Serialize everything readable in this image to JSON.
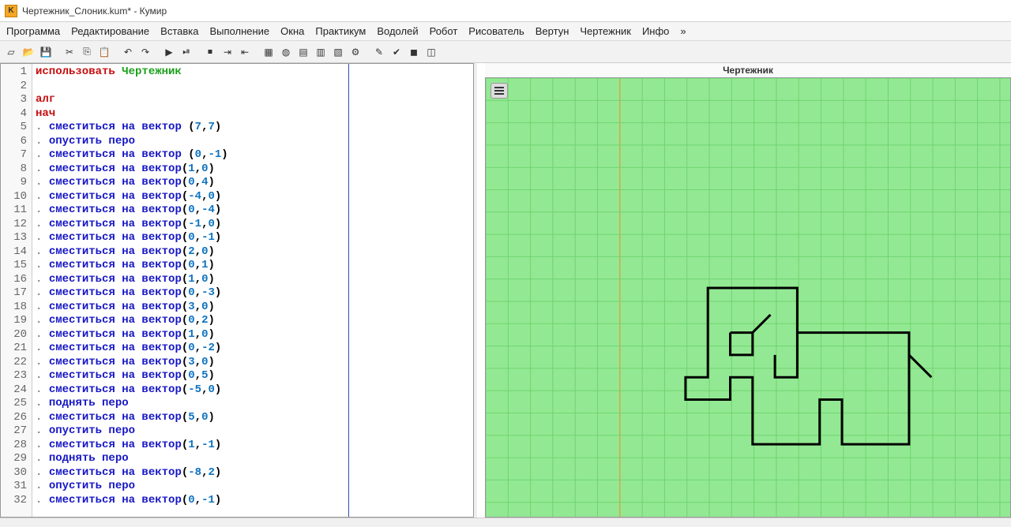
{
  "window": {
    "title": "Чертежник_Слоник.kum* - Кумир"
  },
  "menu": [
    "Программа",
    "Редактирование",
    "Вставка",
    "Выполнение",
    "Окна",
    "Практикум",
    "Водолей",
    "Робот",
    "Рисователь",
    "Вертун",
    "Чертежник",
    "Инфо",
    "»"
  ],
  "right_title": "Чертежник",
  "code": {
    "lines": [
      {
        "n": 1,
        "t": [
          {
            "c": "kw",
            "s": "использовать "
          },
          {
            "c": "grn",
            "s": "Чертежник"
          }
        ]
      },
      {
        "n": 2,
        "t": []
      },
      {
        "n": 3,
        "t": [
          {
            "c": "kw",
            "s": "алг"
          }
        ]
      },
      {
        "n": 4,
        "t": [
          {
            "c": "kw",
            "s": "нач"
          }
        ]
      },
      {
        "n": 5,
        "t": [
          {
            "c": "dot",
            "s": ". "
          },
          {
            "c": "cmd",
            "s": "сместиться на вектор "
          },
          {
            "c": "",
            "s": "("
          },
          {
            "c": "num",
            "s": "7"
          },
          {
            "c": "",
            "s": ","
          },
          {
            "c": "num",
            "s": "7"
          },
          {
            "c": "",
            "s": ")"
          }
        ]
      },
      {
        "n": 6,
        "t": [
          {
            "c": "dot",
            "s": ". "
          },
          {
            "c": "cmd",
            "s": "опустить перо"
          }
        ]
      },
      {
        "n": 7,
        "t": [
          {
            "c": "dot",
            "s": ". "
          },
          {
            "c": "cmd",
            "s": "сместиться на вектор "
          },
          {
            "c": "",
            "s": "("
          },
          {
            "c": "num",
            "s": "0"
          },
          {
            "c": "",
            "s": ","
          },
          {
            "c": "num",
            "s": "-1"
          },
          {
            "c": "",
            "s": ")"
          }
        ]
      },
      {
        "n": 8,
        "t": [
          {
            "c": "dot",
            "s": ". "
          },
          {
            "c": "cmd",
            "s": "сместиться на вектор"
          },
          {
            "c": "",
            "s": "("
          },
          {
            "c": "num",
            "s": "1"
          },
          {
            "c": "",
            "s": ","
          },
          {
            "c": "num",
            "s": "0"
          },
          {
            "c": "",
            "s": ")"
          }
        ]
      },
      {
        "n": 9,
        "t": [
          {
            "c": "dot",
            "s": ". "
          },
          {
            "c": "cmd",
            "s": "сместиться на вектор"
          },
          {
            "c": "",
            "s": "("
          },
          {
            "c": "num",
            "s": "0"
          },
          {
            "c": "",
            "s": ","
          },
          {
            "c": "num",
            "s": "4"
          },
          {
            "c": "",
            "s": ")"
          }
        ]
      },
      {
        "n": 10,
        "t": [
          {
            "c": "dot",
            "s": ". "
          },
          {
            "c": "cmd",
            "s": "сместиться на вектор"
          },
          {
            "c": "",
            "s": "("
          },
          {
            "c": "num",
            "s": "-4"
          },
          {
            "c": "",
            "s": ","
          },
          {
            "c": "num",
            "s": "0"
          },
          {
            "c": "",
            "s": ")"
          }
        ]
      },
      {
        "n": 11,
        "t": [
          {
            "c": "dot",
            "s": ". "
          },
          {
            "c": "cmd",
            "s": "сместиться на вектор"
          },
          {
            "c": "",
            "s": "("
          },
          {
            "c": "num",
            "s": "0"
          },
          {
            "c": "",
            "s": ","
          },
          {
            "c": "num",
            "s": "-4"
          },
          {
            "c": "",
            "s": ")"
          }
        ]
      },
      {
        "n": 12,
        "t": [
          {
            "c": "dot",
            "s": ". "
          },
          {
            "c": "cmd",
            "s": "сместиться на вектор"
          },
          {
            "c": "",
            "s": "("
          },
          {
            "c": "num",
            "s": "-1"
          },
          {
            "c": "",
            "s": ","
          },
          {
            "c": "num",
            "s": "0"
          },
          {
            "c": "",
            "s": ")"
          }
        ]
      },
      {
        "n": 13,
        "t": [
          {
            "c": "dot",
            "s": ". "
          },
          {
            "c": "cmd",
            "s": "сместиться на вектор"
          },
          {
            "c": "",
            "s": "("
          },
          {
            "c": "num",
            "s": "0"
          },
          {
            "c": "",
            "s": ","
          },
          {
            "c": "num",
            "s": "-1"
          },
          {
            "c": "",
            "s": ")"
          }
        ]
      },
      {
        "n": 14,
        "t": [
          {
            "c": "dot",
            "s": ". "
          },
          {
            "c": "cmd",
            "s": "сместиться на вектор"
          },
          {
            "c": "",
            "s": "("
          },
          {
            "c": "num",
            "s": "2"
          },
          {
            "c": "",
            "s": ","
          },
          {
            "c": "num",
            "s": "0"
          },
          {
            "c": "",
            "s": ")"
          }
        ]
      },
      {
        "n": 15,
        "t": [
          {
            "c": "dot",
            "s": ". "
          },
          {
            "c": "cmd",
            "s": "сместиться на вектор"
          },
          {
            "c": "",
            "s": "("
          },
          {
            "c": "num",
            "s": "0"
          },
          {
            "c": "",
            "s": ","
          },
          {
            "c": "num",
            "s": "1"
          },
          {
            "c": "",
            "s": ")"
          }
        ]
      },
      {
        "n": 16,
        "t": [
          {
            "c": "dot",
            "s": ". "
          },
          {
            "c": "cmd",
            "s": "сместиться на вектор"
          },
          {
            "c": "",
            "s": "("
          },
          {
            "c": "num",
            "s": "1"
          },
          {
            "c": "",
            "s": ","
          },
          {
            "c": "num",
            "s": "0"
          },
          {
            "c": "",
            "s": ")"
          }
        ]
      },
      {
        "n": 17,
        "t": [
          {
            "c": "dot",
            "s": ". "
          },
          {
            "c": "cmd",
            "s": "сместиться на вектор"
          },
          {
            "c": "",
            "s": "("
          },
          {
            "c": "num",
            "s": "0"
          },
          {
            "c": "",
            "s": ","
          },
          {
            "c": "num",
            "s": "-3"
          },
          {
            "c": "",
            "s": ")"
          }
        ]
      },
      {
        "n": 18,
        "t": [
          {
            "c": "dot",
            "s": ". "
          },
          {
            "c": "cmd",
            "s": "сместиться на вектор"
          },
          {
            "c": "",
            "s": "("
          },
          {
            "c": "num",
            "s": "3"
          },
          {
            "c": "",
            "s": ","
          },
          {
            "c": "num",
            "s": "0"
          },
          {
            "c": "",
            "s": ")"
          }
        ]
      },
      {
        "n": 19,
        "t": [
          {
            "c": "dot",
            "s": ". "
          },
          {
            "c": "cmd",
            "s": "сместиться на вектор"
          },
          {
            "c": "",
            "s": "("
          },
          {
            "c": "num",
            "s": "0"
          },
          {
            "c": "",
            "s": ","
          },
          {
            "c": "num",
            "s": "2"
          },
          {
            "c": "",
            "s": ")"
          }
        ]
      },
      {
        "n": 20,
        "t": [
          {
            "c": "dot",
            "s": ". "
          },
          {
            "c": "cmd",
            "s": "сместиться на вектор"
          },
          {
            "c": "",
            "s": "("
          },
          {
            "c": "num",
            "s": "1"
          },
          {
            "c": "",
            "s": ","
          },
          {
            "c": "num",
            "s": "0"
          },
          {
            "c": "",
            "s": ")"
          }
        ]
      },
      {
        "n": 21,
        "t": [
          {
            "c": "dot",
            "s": ". "
          },
          {
            "c": "cmd",
            "s": "сместиться на вектор"
          },
          {
            "c": "",
            "s": "("
          },
          {
            "c": "num",
            "s": "0"
          },
          {
            "c": "",
            "s": ","
          },
          {
            "c": "num",
            "s": "-2"
          },
          {
            "c": "",
            "s": ")"
          }
        ]
      },
      {
        "n": 22,
        "t": [
          {
            "c": "dot",
            "s": ". "
          },
          {
            "c": "cmd",
            "s": "сместиться на вектор"
          },
          {
            "c": "",
            "s": "("
          },
          {
            "c": "num",
            "s": "3"
          },
          {
            "c": "",
            "s": ","
          },
          {
            "c": "num",
            "s": "0"
          },
          {
            "c": "",
            "s": ")"
          }
        ]
      },
      {
        "n": 23,
        "t": [
          {
            "c": "dot",
            "s": ". "
          },
          {
            "c": "cmd",
            "s": "сместиться на вектор"
          },
          {
            "c": "",
            "s": "("
          },
          {
            "c": "num",
            "s": "0"
          },
          {
            "c": "",
            "s": ","
          },
          {
            "c": "num",
            "s": "5"
          },
          {
            "c": "",
            "s": ")"
          }
        ]
      },
      {
        "n": 24,
        "t": [
          {
            "c": "dot",
            "s": ". "
          },
          {
            "c": "cmd",
            "s": "сместиться на вектор"
          },
          {
            "c": "",
            "s": "("
          },
          {
            "c": "num",
            "s": "-5"
          },
          {
            "c": "",
            "s": ","
          },
          {
            "c": "num",
            "s": "0"
          },
          {
            "c": "",
            "s": ")"
          }
        ]
      },
      {
        "n": 25,
        "t": [
          {
            "c": "dot",
            "s": ". "
          },
          {
            "c": "cmd",
            "s": "поднять перо"
          }
        ]
      },
      {
        "n": 26,
        "t": [
          {
            "c": "dot",
            "s": ". "
          },
          {
            "c": "cmd",
            "s": "сместиться на вектор"
          },
          {
            "c": "",
            "s": "("
          },
          {
            "c": "num",
            "s": "5"
          },
          {
            "c": "",
            "s": ","
          },
          {
            "c": "num",
            "s": "0"
          },
          {
            "c": "",
            "s": ")"
          }
        ]
      },
      {
        "n": 27,
        "t": [
          {
            "c": "dot",
            "s": ". "
          },
          {
            "c": "cmd",
            "s": "опустить перо"
          }
        ]
      },
      {
        "n": 28,
        "t": [
          {
            "c": "dot",
            "s": ". "
          },
          {
            "c": "cmd",
            "s": "сместиться на вектор"
          },
          {
            "c": "",
            "s": "("
          },
          {
            "c": "num",
            "s": "1"
          },
          {
            "c": "",
            "s": ","
          },
          {
            "c": "num",
            "s": "-1"
          },
          {
            "c": "",
            "s": ")"
          }
        ]
      },
      {
        "n": 29,
        "t": [
          {
            "c": "dot",
            "s": ". "
          },
          {
            "c": "cmd",
            "s": "поднять перо"
          }
        ]
      },
      {
        "n": 30,
        "t": [
          {
            "c": "dot",
            "s": ". "
          },
          {
            "c": "cmd",
            "s": "сместиться на вектор"
          },
          {
            "c": "",
            "s": "("
          },
          {
            "c": "num",
            "s": "-8"
          },
          {
            "c": "",
            "s": ","
          },
          {
            "c": "num",
            "s": "2"
          },
          {
            "c": "",
            "s": ")"
          }
        ]
      },
      {
        "n": 31,
        "t": [
          {
            "c": "dot",
            "s": ". "
          },
          {
            "c": "cmd",
            "s": "опустить перо"
          }
        ]
      },
      {
        "n": 32,
        "t": [
          {
            "c": "dot",
            "s": ". "
          },
          {
            "c": "cmd",
            "s": "сместиться на вектор"
          },
          {
            "c": "",
            "s": "("
          },
          {
            "c": "num",
            "s": "0"
          },
          {
            "c": "",
            "s": ","
          },
          {
            "c": "num",
            "s": "-1"
          },
          {
            "c": "",
            "s": ")"
          }
        ]
      }
    ]
  },
  "toolbar_icons": [
    "new",
    "open",
    "save",
    "",
    "cut",
    "copy",
    "paste",
    "",
    "undo",
    "redo",
    "",
    "run",
    "step",
    "",
    "stop",
    "break1",
    "break2",
    "",
    "grid1",
    "globe",
    "table1",
    "table2",
    "table3",
    "bug",
    "",
    "pencil",
    "check",
    "green1",
    "green2"
  ]
}
